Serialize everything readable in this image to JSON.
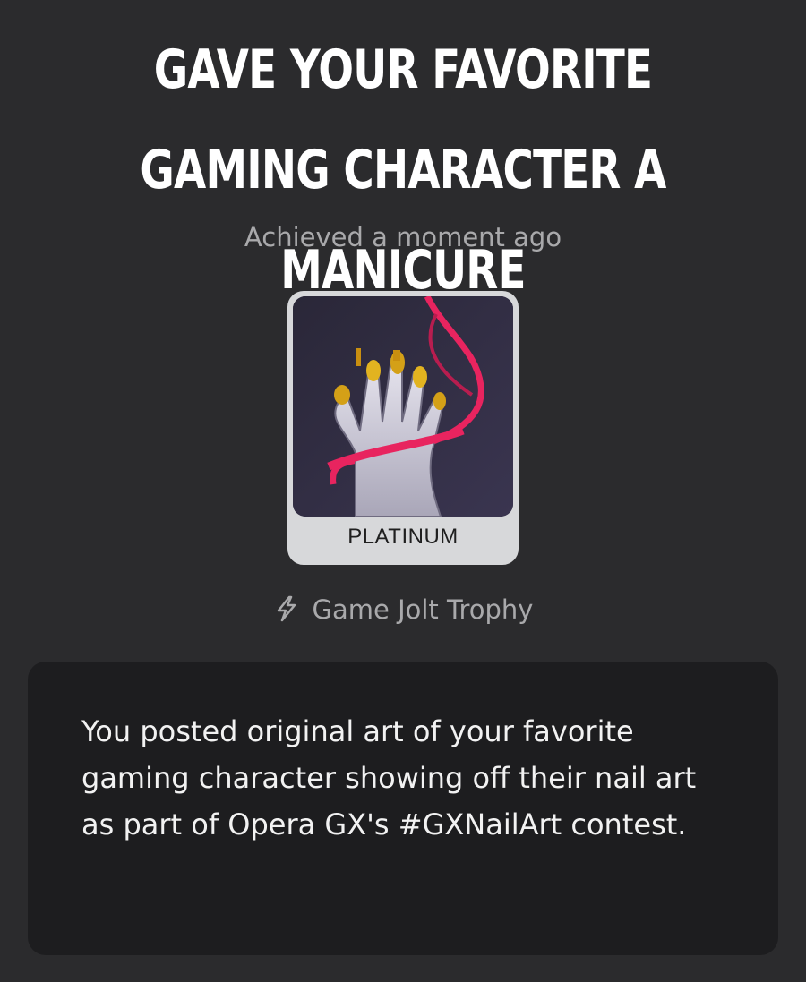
{
  "trophy": {
    "title": "GAVE YOUR FAVORITE GAMING CHARACTER A MANICURE",
    "achieved": "Achieved a moment ago",
    "tier": "PLATINUM",
    "source": "Game Jolt Trophy",
    "source_icon": "bolt-icon",
    "description": "You posted original art of your favorite gaming character showing off their nail art as part of Opera GX's #GXNailArt contest."
  },
  "colors": {
    "background": "#2b2b2d",
    "card": "#1d1d1f",
    "tier_plate": "#d7d8da",
    "accent_pink": "#e8245f",
    "muted_text": "#a9a9ab"
  }
}
